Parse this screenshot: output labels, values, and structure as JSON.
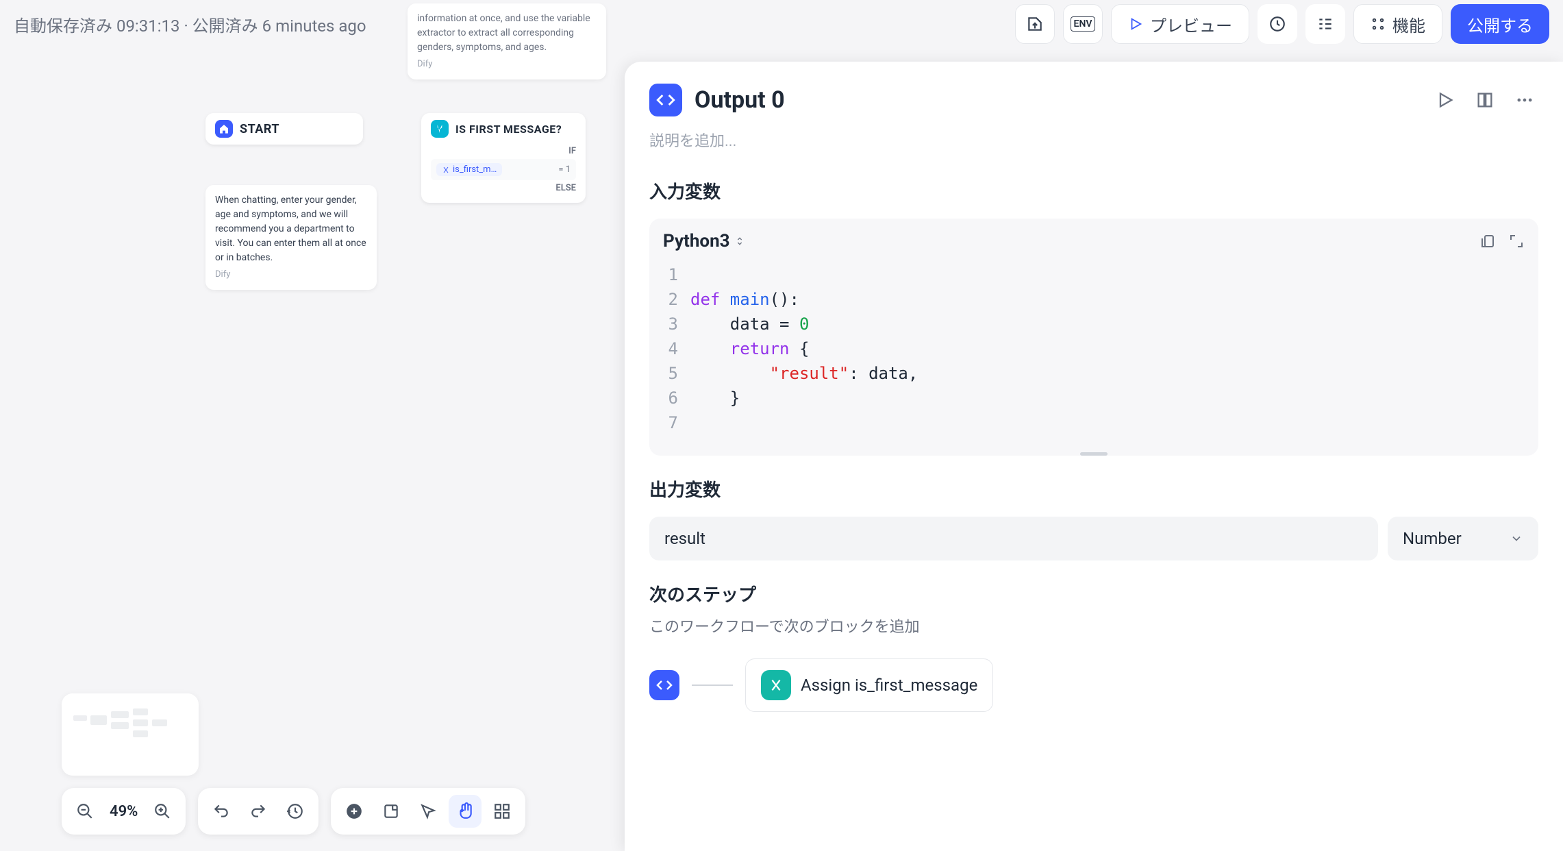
{
  "topbar": {
    "status": "自動保存済み 09:31:13 · 公開済み 6 minutes ago",
    "preview": "プレビュー",
    "features": "機能",
    "publish": "公開する",
    "env_label": "ENV"
  },
  "canvas": {
    "start_label": "START",
    "condition_label": "IS FIRST MESSAGE?",
    "condition_if": "IF",
    "condition_else": "ELSE",
    "condition_var": "is_first_m…",
    "condition_eq": "= 1",
    "note_top_text": "information at once, and use the variable extractor to extract all corresponding genders, symptoms, and ages.",
    "note_top_author": "Dify",
    "note_start_text": "When chatting, enter your gender, age and symptoms, and we will recommend you a department to visit. You can enter them all at once or in batches.",
    "note_start_author": "Dify"
  },
  "panel": {
    "title": "Output 0",
    "desc_placeholder": "説明を追加...",
    "input_vars_title": "入力変数",
    "lang": "Python3",
    "code": {
      "l1": "",
      "l2_def": "def",
      "l2_main": " main",
      "l2_paren": "():",
      "l3_indent": "    data = ",
      "l3_zero": "0",
      "l4_indent": "    ",
      "l4_return": "return",
      "l4_brace": " {",
      "l5_indent": "        ",
      "l5_key": "\"result\"",
      "l5_rest": ": data,",
      "l6": "    }",
      "l7": ""
    },
    "output_vars_title": "出力変数",
    "output_name": "result",
    "output_type": "Number",
    "next_step_title": "次のステップ",
    "next_step_sub": "このワークフローで次のブロックを追加",
    "next_block_label": "Assign is_first_message"
  },
  "bottombar": {
    "zoom": "49%"
  }
}
